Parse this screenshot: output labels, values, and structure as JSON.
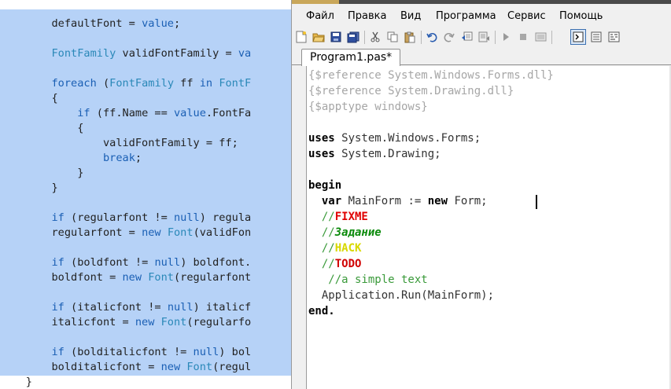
{
  "background_editor": {
    "lines": [
      [
        {
          "t": "        defaultFont = ",
          "c": ""
        },
        {
          "t": "value",
          "c": "kw"
        },
        {
          "t": ";",
          "c": ""
        }
      ],
      [],
      [
        {
          "t": "        ",
          "c": ""
        },
        {
          "t": "FontFamily",
          "c": "tp"
        },
        {
          "t": " validFontFamily = ",
          "c": ""
        },
        {
          "t": "va",
          "c": "kw"
        }
      ],
      [],
      [
        {
          "t": "        ",
          "c": ""
        },
        {
          "t": "foreach",
          "c": "kw"
        },
        {
          "t": " (",
          "c": ""
        },
        {
          "t": "FontFamily",
          "c": "tp"
        },
        {
          "t": " ff ",
          "c": ""
        },
        {
          "t": "in",
          "c": "kw"
        },
        {
          "t": " ",
          "c": ""
        },
        {
          "t": "FontF",
          "c": "tp"
        }
      ],
      [
        {
          "t": "        {",
          "c": ""
        }
      ],
      [
        {
          "t": "            ",
          "c": ""
        },
        {
          "t": "if",
          "c": "kw"
        },
        {
          "t": " (ff.Name == ",
          "c": ""
        },
        {
          "t": "value",
          "c": "kw"
        },
        {
          "t": ".FontFa",
          "c": ""
        }
      ],
      [
        {
          "t": "            {",
          "c": ""
        }
      ],
      [
        {
          "t": "                validFontFamily = ff;",
          "c": ""
        }
      ],
      [
        {
          "t": "                ",
          "c": ""
        },
        {
          "t": "break",
          "c": "kw"
        },
        {
          "t": ";",
          "c": ""
        }
      ],
      [
        {
          "t": "            }",
          "c": ""
        }
      ],
      [
        {
          "t": "        }",
          "c": ""
        }
      ],
      [],
      [
        {
          "t": "        ",
          "c": ""
        },
        {
          "t": "if",
          "c": "kw"
        },
        {
          "t": " (regularfont != ",
          "c": ""
        },
        {
          "t": "null",
          "c": "kw"
        },
        {
          "t": ") regula",
          "c": ""
        }
      ],
      [
        {
          "t": "        regularfont = ",
          "c": ""
        },
        {
          "t": "new",
          "c": "kw"
        },
        {
          "t": " ",
          "c": ""
        },
        {
          "t": "Font",
          "c": "tp"
        },
        {
          "t": "(validFon",
          "c": ""
        }
      ],
      [],
      [
        {
          "t": "        ",
          "c": ""
        },
        {
          "t": "if",
          "c": "kw"
        },
        {
          "t": " (boldfont != ",
          "c": ""
        },
        {
          "t": "null",
          "c": "kw"
        },
        {
          "t": ") boldfont.",
          "c": ""
        }
      ],
      [
        {
          "t": "        boldfont = ",
          "c": ""
        },
        {
          "t": "new",
          "c": "kw"
        },
        {
          "t": " ",
          "c": ""
        },
        {
          "t": "Font",
          "c": "tp"
        },
        {
          "t": "(regularfont",
          "c": ""
        }
      ],
      [],
      [
        {
          "t": "        ",
          "c": ""
        },
        {
          "t": "if",
          "c": "kw"
        },
        {
          "t": " (italicfont != ",
          "c": ""
        },
        {
          "t": "null",
          "c": "kw"
        },
        {
          "t": ") italicf",
          "c": ""
        }
      ],
      [
        {
          "t": "        italicfont = ",
          "c": ""
        },
        {
          "t": "new",
          "c": "kw"
        },
        {
          "t": " ",
          "c": ""
        },
        {
          "t": "Font",
          "c": "tp"
        },
        {
          "t": "(regularfo",
          "c": ""
        }
      ],
      [],
      [
        {
          "t": "        ",
          "c": ""
        },
        {
          "t": "if",
          "c": "kw"
        },
        {
          "t": " (bolditalicfont != ",
          "c": ""
        },
        {
          "t": "null",
          "c": "kw"
        },
        {
          "t": ") bol",
          "c": ""
        }
      ],
      [
        {
          "t": "        bolditalicfont = ",
          "c": ""
        },
        {
          "t": "new",
          "c": "kw"
        },
        {
          "t": " ",
          "c": ""
        },
        {
          "t": "Font",
          "c": "tp"
        },
        {
          "t": "(regul",
          "c": ""
        }
      ],
      [
        {
          "t": "    }",
          "c": ""
        }
      ]
    ]
  },
  "menu": {
    "file": "Файл",
    "edit": "Правка",
    "view": "Вид",
    "program": "Программа",
    "service": "Сервис",
    "help": "Помощь"
  },
  "toolbar": {
    "buttons": [
      "new-file-icon",
      "open-folder-icon",
      "save-icon",
      "save-all-icon",
      "cut-icon",
      "copy-icon",
      "paste-icon",
      "undo-icon",
      "redo-icon",
      "format-code-icon",
      "compile-icon",
      "run-icon",
      "stop-icon",
      "debug-icon",
      "console-output-icon",
      "list-icon",
      "code-window-icon"
    ]
  },
  "tabs": [
    {
      "label": "Program1.pas*"
    }
  ],
  "code": {
    "lines": [
      [
        {
          "t": "{$reference System.Windows.Forms.dll}",
          "c": "dir"
        }
      ],
      [
        {
          "t": "{$reference System.Drawing.dll}",
          "c": "dir"
        }
      ],
      [
        {
          "t": "{$apptype windows}",
          "c": "dir"
        }
      ],
      [],
      [
        {
          "t": "uses",
          "c": "kw"
        },
        {
          "t": " System.Windows.Forms;",
          "c": ""
        }
      ],
      [
        {
          "t": "uses",
          "c": "kw"
        },
        {
          "t": " System.Drawing;",
          "c": ""
        }
      ],
      [],
      [
        {
          "t": "begin",
          "c": "kw"
        }
      ],
      [
        {
          "t": "  ",
          "c": ""
        },
        {
          "t": "var",
          "c": "kw"
        },
        {
          "t": " MainForm := ",
          "c": ""
        },
        {
          "t": "new",
          "c": "kw"
        },
        {
          "t": " Form;",
          "c": ""
        }
      ],
      [
        {
          "t": "  //",
          "c": "com"
        },
        {
          "t": "FIXME",
          "c": "fixme"
        }
      ],
      [
        {
          "t": "  //",
          "c": "com"
        },
        {
          "t": "Задание",
          "c": "zad"
        }
      ],
      [
        {
          "t": "  //",
          "c": "com"
        },
        {
          "t": "HACK",
          "c": "hack"
        }
      ],
      [
        {
          "t": "  //",
          "c": "com"
        },
        {
          "t": "TODO",
          "c": "todo"
        }
      ],
      [
        {
          "t": "   //a simple text",
          "c": "com"
        }
      ],
      [
        {
          "t": "  Application.Run(MainForm);",
          "c": ""
        }
      ],
      [
        {
          "t": "end.",
          "c": "kw"
        }
      ]
    ]
  }
}
